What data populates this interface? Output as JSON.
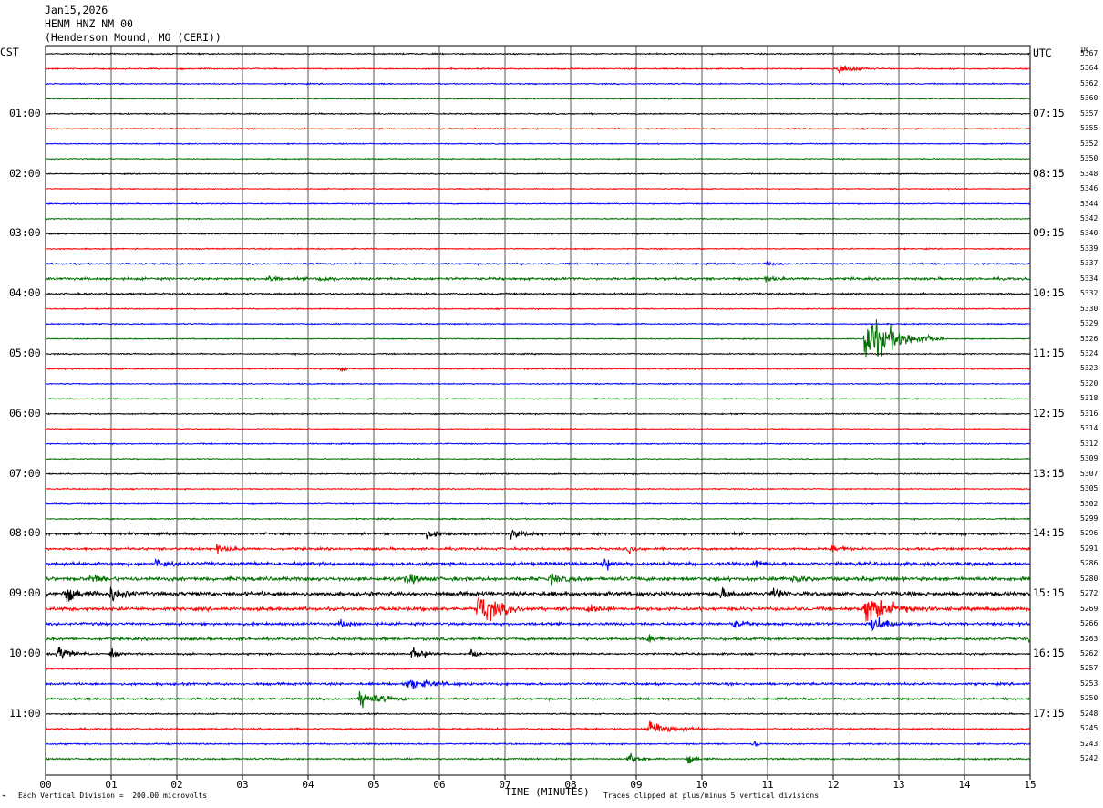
{
  "header": {
    "date": "Jan15,2026",
    "station": "HENM HNZ NM 00",
    "location": "(Henderson Mound, MO (CERI))"
  },
  "chart_data": {
    "type": "line",
    "subtype": "helicorder",
    "left_axis_label": "CST",
    "right_axis_label": "UTC",
    "dc_label": "DC",
    "xlabel": "TIME (MINUTES)",
    "x_ticks": [
      "00",
      "01",
      "02",
      "03",
      "04",
      "05",
      "06",
      "07",
      "08",
      "09",
      "10",
      "11",
      "12",
      "13",
      "14",
      "15"
    ],
    "xlim": [
      0,
      15
    ],
    "rows": 48,
    "row_colors": [
      "#000000",
      "#ff0000",
      "#0000ff",
      "#007000"
    ],
    "left_time_labels": [
      {
        "row": 4,
        "text": "01:00"
      },
      {
        "row": 8,
        "text": "02:00"
      },
      {
        "row": 12,
        "text": "03:00"
      },
      {
        "row": 16,
        "text": "04:00"
      },
      {
        "row": 20,
        "text": "05:00"
      },
      {
        "row": 24,
        "text": "06:00"
      },
      {
        "row": 28,
        "text": "07:00"
      },
      {
        "row": 32,
        "text": "08:00"
      },
      {
        "row": 36,
        "text": "09:00"
      },
      {
        "row": 40,
        "text": "10:00"
      },
      {
        "row": 44,
        "text": "11:00"
      }
    ],
    "right_time_labels": [
      {
        "row": 0,
        "text": "UTC"
      },
      {
        "row": 4,
        "text": "07:15"
      },
      {
        "row": 8,
        "text": "08:15"
      },
      {
        "row": 12,
        "text": "09:15"
      },
      {
        "row": 16,
        "text": "10:15"
      },
      {
        "row": 20,
        "text": "11:15"
      },
      {
        "row": 24,
        "text": "12:15"
      },
      {
        "row": 28,
        "text": "13:15"
      },
      {
        "row": 32,
        "text": "14:15"
      },
      {
        "row": 36,
        "text": "15:15"
      },
      {
        "row": 40,
        "text": "16:15"
      },
      {
        "row": 44,
        "text": "17:15"
      }
    ],
    "dc_values": [
      "5367",
      "5364",
      "5362",
      "5360",
      "5357",
      "5355",
      "5352",
      "5350",
      "5348",
      "5346",
      "5344",
      "5342",
      "5340",
      "5339",
      "5337",
      "5334",
      "5332",
      "5330",
      "5329",
      "5326",
      "5324",
      "5323",
      "5320",
      "5318",
      "5316",
      "5314",
      "5312",
      "5309",
      "5307",
      "5305",
      "5302",
      "5299",
      "5296",
      "5291",
      "5286",
      "5280",
      "5272",
      "5269",
      "5266",
      "5263",
      "5262",
      "5257",
      "5253",
      "5250",
      "5248",
      "5245",
      "5243",
      "5242"
    ],
    "trace_noise": [
      0.9,
      1.0,
      0.9,
      0.8,
      0.9,
      0.9,
      0.8,
      0.8,
      0.8,
      0.8,
      0.8,
      0.8,
      0.9,
      0.9,
      1.2,
      1.8,
      1.3,
      0.9,
      0.9,
      0.8,
      0.9,
      1.0,
      0.9,
      0.8,
      0.9,
      0.8,
      0.9,
      0.8,
      0.9,
      0.9,
      0.9,
      1.0,
      1.8,
      1.8,
      2.6,
      2.8,
      3.0,
      2.6,
      2.0,
      2.0,
      1.4,
      1.0,
      1.8,
      1.6,
      1.0,
      1.2,
      1.1,
      1.2
    ],
    "events": [
      {
        "row": 1,
        "minute": 12.1,
        "amp": 9,
        "dur": 0.6
      },
      {
        "row": 14,
        "minute": 11.0,
        "amp": 4,
        "dur": 0.3
      },
      {
        "row": 15,
        "minute": 3.4,
        "amp": 5,
        "dur": 0.3
      },
      {
        "row": 15,
        "minute": 4.2,
        "amp": 5,
        "dur": 0.3
      },
      {
        "row": 15,
        "minute": 11.0,
        "amp": 5,
        "dur": 0.3
      },
      {
        "row": 19,
        "minute": 12.5,
        "amp": 42,
        "dur": 1.2
      },
      {
        "row": 21,
        "minute": 4.5,
        "amp": 4,
        "dur": 0.2
      },
      {
        "row": 32,
        "minute": 5.8,
        "amp": 5,
        "dur": 0.6
      },
      {
        "row": 32,
        "minute": 7.1,
        "amp": 7,
        "dur": 0.5
      },
      {
        "row": 33,
        "minute": 2.6,
        "amp": 6,
        "dur": 0.5
      },
      {
        "row": 33,
        "minute": 8.9,
        "amp": 6,
        "dur": 0.3
      },
      {
        "row": 33,
        "minute": 12.0,
        "amp": 6,
        "dur": 0.3
      },
      {
        "row": 33,
        "minute": 15.0,
        "amp": 8,
        "dur": 0.2
      },
      {
        "row": 34,
        "minute": 1.7,
        "amp": 8,
        "dur": 0.4
      },
      {
        "row": 34,
        "minute": 8.5,
        "amp": 9,
        "dur": 0.4
      },
      {
        "row": 34,
        "minute": 10.8,
        "amp": 6,
        "dur": 0.3
      },
      {
        "row": 35,
        "minute": 0.7,
        "amp": 6,
        "dur": 0.4
      },
      {
        "row": 35,
        "minute": 5.5,
        "amp": 7,
        "dur": 0.5
      },
      {
        "row": 35,
        "minute": 7.7,
        "amp": 7,
        "dur": 0.5
      },
      {
        "row": 35,
        "minute": 11.4,
        "amp": 6,
        "dur": 0.4
      },
      {
        "row": 36,
        "minute": 0.3,
        "amp": 12,
        "dur": 0.5
      },
      {
        "row": 36,
        "minute": 1.0,
        "amp": 12,
        "dur": 0.4
      },
      {
        "row": 36,
        "minute": 11.1,
        "amp": 10,
        "dur": 0.3
      },
      {
        "row": 36,
        "minute": 10.3,
        "amp": 8,
        "dur": 0.3
      },
      {
        "row": 37,
        "minute": 6.6,
        "amp": 26,
        "dur": 0.8
      },
      {
        "row": 37,
        "minute": 12.5,
        "amp": 24,
        "dur": 1.0
      },
      {
        "row": 37,
        "minute": 8.3,
        "amp": 8,
        "dur": 0.4
      },
      {
        "row": 38,
        "minute": 12.6,
        "amp": 16,
        "dur": 0.6
      },
      {
        "row": 38,
        "minute": 10.5,
        "amp": 7,
        "dur": 0.3
      },
      {
        "row": 38,
        "minute": 4.5,
        "amp": 6,
        "dur": 0.4
      },
      {
        "row": 39,
        "minute": 15.0,
        "amp": 9,
        "dur": 0.2
      },
      {
        "row": 39,
        "minute": 9.2,
        "amp": 6,
        "dur": 0.3
      },
      {
        "row": 40,
        "minute": 0.2,
        "amp": 11,
        "dur": 0.5
      },
      {
        "row": 40,
        "minute": 1.0,
        "amp": 8,
        "dur": 0.2
      },
      {
        "row": 40,
        "minute": 5.6,
        "amp": 10,
        "dur": 0.5
      },
      {
        "row": 40,
        "minute": 6.5,
        "amp": 10,
        "dur": 0.2
      },
      {
        "row": 42,
        "minute": 5.5,
        "amp": 9,
        "dur": 1.0
      },
      {
        "row": 43,
        "minute": 4.8,
        "amp": 14,
        "dur": 0.7
      },
      {
        "row": 45,
        "minute": 9.2,
        "amp": 14,
        "dur": 0.8
      },
      {
        "row": 46,
        "minute": 10.8,
        "amp": 4,
        "dur": 0.2
      },
      {
        "row": 47,
        "minute": 8.9,
        "amp": 10,
        "dur": 0.4
      },
      {
        "row": 47,
        "minute": 9.8,
        "amp": 7,
        "dur": 0.3
      }
    ]
  },
  "footer": {
    "scale_note": "Each Vertical Division =  200.00 microvolts",
    "clip_note": "Traces clipped at plus/minus 5 vertical divisions"
  }
}
